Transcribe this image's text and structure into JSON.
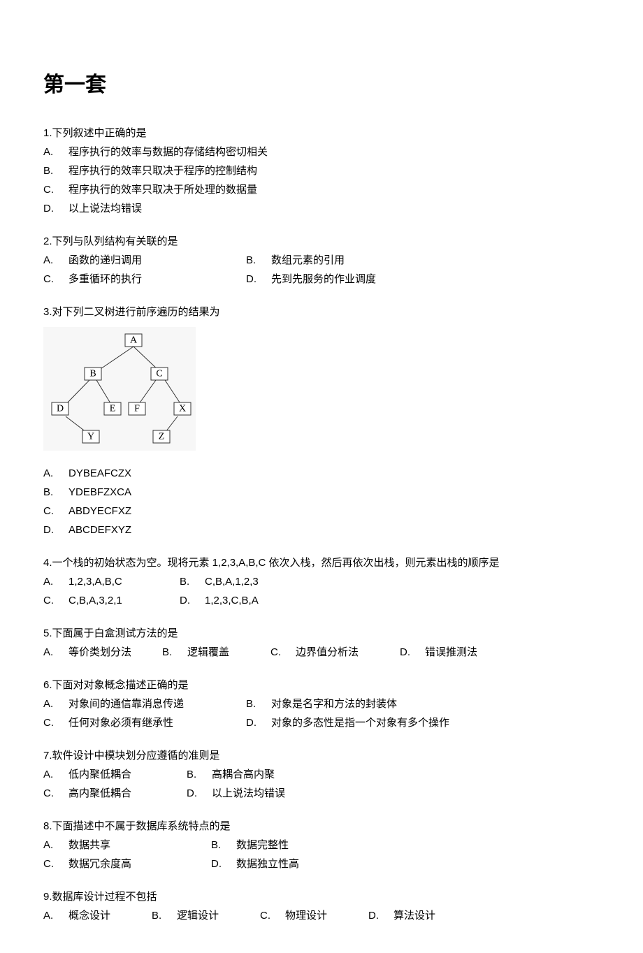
{
  "title": "第一套",
  "q1": {
    "stem": "1.下列叙述中正确的是",
    "a": "程序执行的效率与数据的存储结构密切相关",
    "b": "程序执行的效率只取决于程序的控制结构",
    "c": "程序执行的效率只取决于所处理的数据量",
    "d": "以上说法均错误"
  },
  "q2": {
    "stem": "2.下列与队列结构有关联的是",
    "a": "函数的递归调用",
    "b": "数组元素的引用",
    "c": "多重循环的执行",
    "d": "先到先服务的作业调度"
  },
  "q3": {
    "stem": "3.对下列二叉树进行前序遍历的结果为",
    "a": "DYBEAFCZX",
    "b": "YDEBFZXCA",
    "c": "ABDYECFXZ",
    "d": "ABCDEFXYZ",
    "tree": {
      "A": "A",
      "B": "B",
      "C": "C",
      "D": "D",
      "E": "E",
      "F": "F",
      "X": "X",
      "Y": "Y",
      "Z": "Z"
    }
  },
  "q4": {
    "stem": "4.一个栈的初始状态为空。现将元素 1,2,3,A,B,C 依次入栈，然后再依次出栈，则元素出栈的顺序是",
    "a": "1,2,3,A,B,C",
    "b": "C,B,A,1,2,3",
    "c": "C,B,A,3,2,1",
    "d": "1,2,3,C,B,A"
  },
  "q5": {
    "stem": "5.下面属于白盒测试方法的是",
    "a": "等价类划分法",
    "b": "逻辑覆盖",
    "c": "边界值分析法",
    "d": "错误推测法"
  },
  "q6": {
    "stem": "6.下面对对象概念描述正确的是",
    "a": "对象间的通信靠消息传递",
    "b": "对象是名字和方法的封装体",
    "c": "任何对象必须有继承性",
    "d": "对象的多态性是指一个对象有多个操作"
  },
  "q7": {
    "stem": "7.软件设计中模块划分应遵循的准则是",
    "a": "低内聚低耦合",
    "b": "高耦合高内聚",
    "c": "高内聚低耦合",
    "d": "以上说法均错误"
  },
  "q8": {
    "stem": "8.下面描述中不属于数据库系统特点的是",
    "a": "数据共享",
    "b": "数据完整性",
    "c": "数据冗余度高",
    "d": "数据独立性高"
  },
  "q9": {
    "stem": "9.数据库设计过程不包括",
    "a": "概念设计",
    "b": "逻辑设计",
    "c": "物理设计",
    "d": "算法设计"
  },
  "letters": {
    "A": "A.",
    "B": "B.",
    "C": "C.",
    "D": "D."
  }
}
